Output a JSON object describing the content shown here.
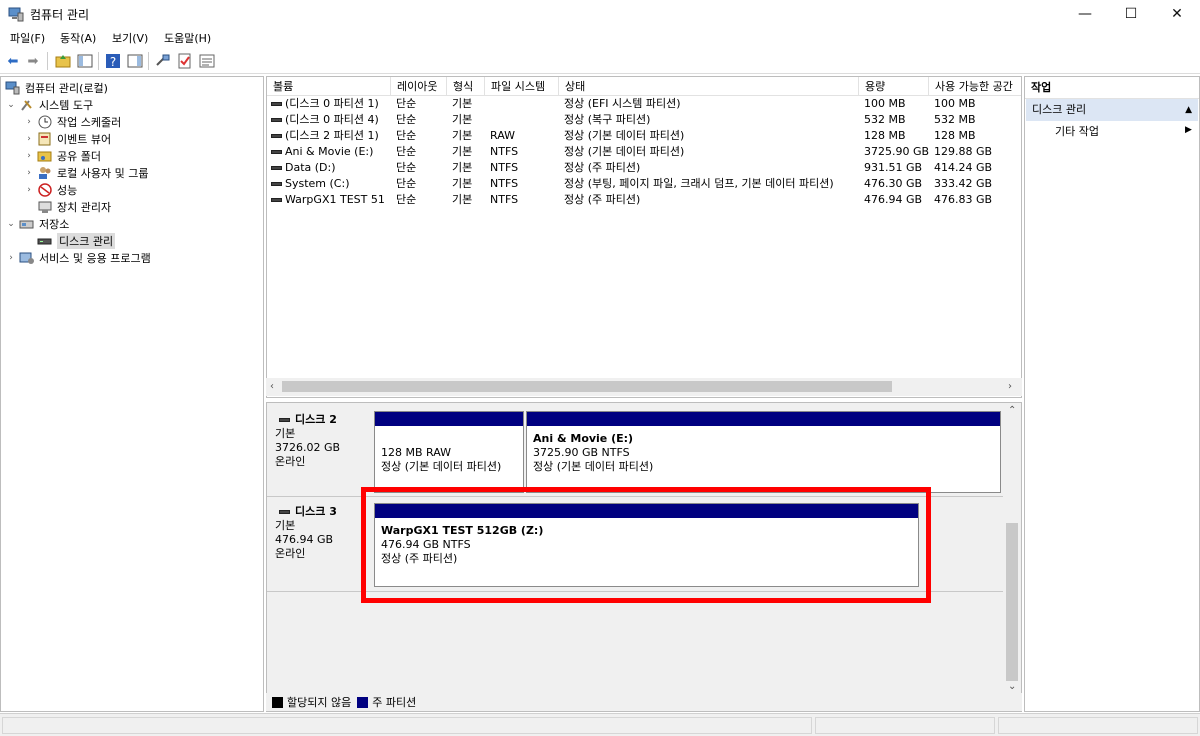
{
  "window": {
    "title": "컴퓨터 관리",
    "minimize": "—",
    "maximize": "☐",
    "close": "✕"
  },
  "menu": [
    "파일(F)",
    "동작(A)",
    "보기(V)",
    "도움말(H)"
  ],
  "tree": {
    "root": "컴퓨터 관리(로컬)",
    "system_tools": "시스템 도구",
    "task_scheduler": "작업 스케줄러",
    "event_viewer": "이벤트 뷰어",
    "shared_folders": "공유 폴더",
    "local_users": "로컬 사용자 및 그룹",
    "performance": "성능",
    "device_manager": "장치 관리자",
    "storage": "저장소",
    "disk_management": "디스크 관리",
    "services": "서비스 및 응용 프로그램"
  },
  "volume_list": {
    "columns": [
      "볼륨",
      "레이아웃",
      "형식",
      "파일 시스템",
      "상태",
      "용량",
      "사용 가능한 공간"
    ],
    "rows": [
      [
        "(디스크 0 파티션 1)",
        "단순",
        "기본",
        "",
        "정상 (EFI 시스템 파티션)",
        "100 MB",
        "100 MB"
      ],
      [
        "(디스크 0 파티션 4)",
        "단순",
        "기본",
        "",
        "정상 (복구 파티션)",
        "532 MB",
        "532 MB"
      ],
      [
        "(디스크 2 파티션 1)",
        "단순",
        "기본",
        "RAW",
        "정상 (기본 데이터 파티션)",
        "128 MB",
        "128 MB"
      ],
      [
        "Ani & Movie (E:)",
        "단순",
        "기본",
        "NTFS",
        "정상 (기본 데이터 파티션)",
        "3725.90 GB",
        "129.88 GB"
      ],
      [
        "Data (D:)",
        "단순",
        "기본",
        "NTFS",
        "정상 (주 파티션)",
        "931.51 GB",
        "414.24 GB"
      ],
      [
        "System (C:)",
        "단순",
        "기본",
        "NTFS",
        "정상 (부팅, 페이지 파일, 크래시 덤프, 기본 데이터 파티션)",
        "476.30 GB",
        "333.42 GB"
      ],
      [
        "WarpGX1 TEST 51...",
        "단순",
        "기본",
        "NTFS",
        "정상 (주 파티션)",
        "476.94 GB",
        "476.83 GB"
      ]
    ]
  },
  "disks": {
    "disk2": {
      "name": "디스크 2",
      "type": "기본",
      "size": "3726.02 GB",
      "status": "온라인",
      "p1_size": "128 MB RAW",
      "p1_status": "정상 (기본 데이터 파티션)",
      "p2_title": "Ani & Movie  (E:)",
      "p2_size": "3725.90 GB NTFS",
      "p2_status": "정상 (기본 데이터 파티션)"
    },
    "disk3": {
      "name": "디스크 3",
      "type": "기본",
      "size": "476.94 GB",
      "status": "온라인",
      "p1_title": "WarpGX1 TEST 512GB  (Z:)",
      "p1_size": "476.94 GB NTFS",
      "p1_status": "정상 (주 파티션)"
    }
  },
  "legend": {
    "unallocated": "할당되지 않음",
    "primary": "주 파티션"
  },
  "actions": {
    "header": "작업",
    "group": "디스크 관리",
    "more": "기타 작업"
  },
  "colors": {
    "partition_bar": "#000080",
    "highlight": "#ff0000",
    "selection": "#dce6f4"
  }
}
